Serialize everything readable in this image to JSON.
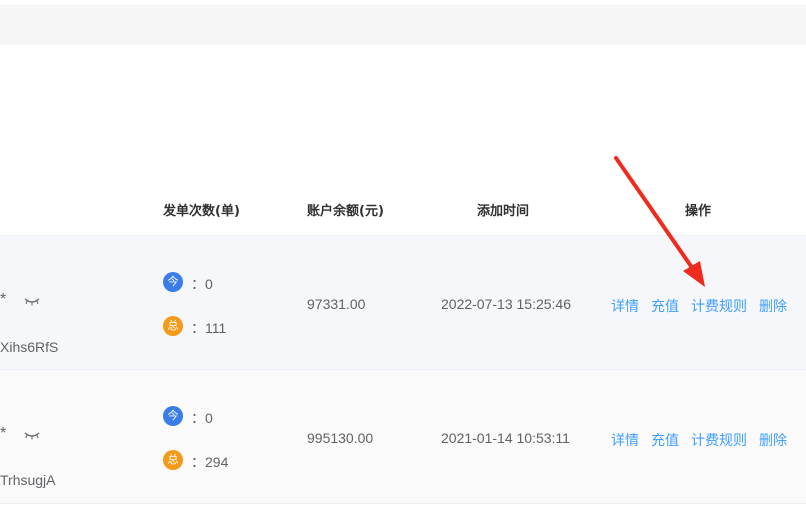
{
  "table": {
    "headers": [
      "发单次数(单)",
      "账户余额(元)",
      "添加时间",
      "操作"
    ],
    "rows": [
      {
        "masked": "*",
        "code": "Xihs6RfS",
        "today_badge": "今",
        "today_count": "：0",
        "total_badge": "总",
        "total_count": "：111",
        "balance": "97331.00",
        "added_time": "2022-07-13 15:25:46"
      },
      {
        "masked": "*",
        "code": "TrhsugjA",
        "today_badge": "今",
        "today_count": "：0",
        "total_badge": "总",
        "total_count": "：294",
        "balance": "995130.00",
        "added_time": "2021-01-14 10:53:11"
      }
    ],
    "actions": [
      "详情",
      "充值",
      "计费规则",
      "删除"
    ]
  },
  "colors": {
    "link": "#409eff",
    "today_badge": "#3a7de8",
    "total_badge": "#f39a1a",
    "arrow": "#f02b1d"
  },
  "icons": [
    "eye-closed-icon"
  ]
}
